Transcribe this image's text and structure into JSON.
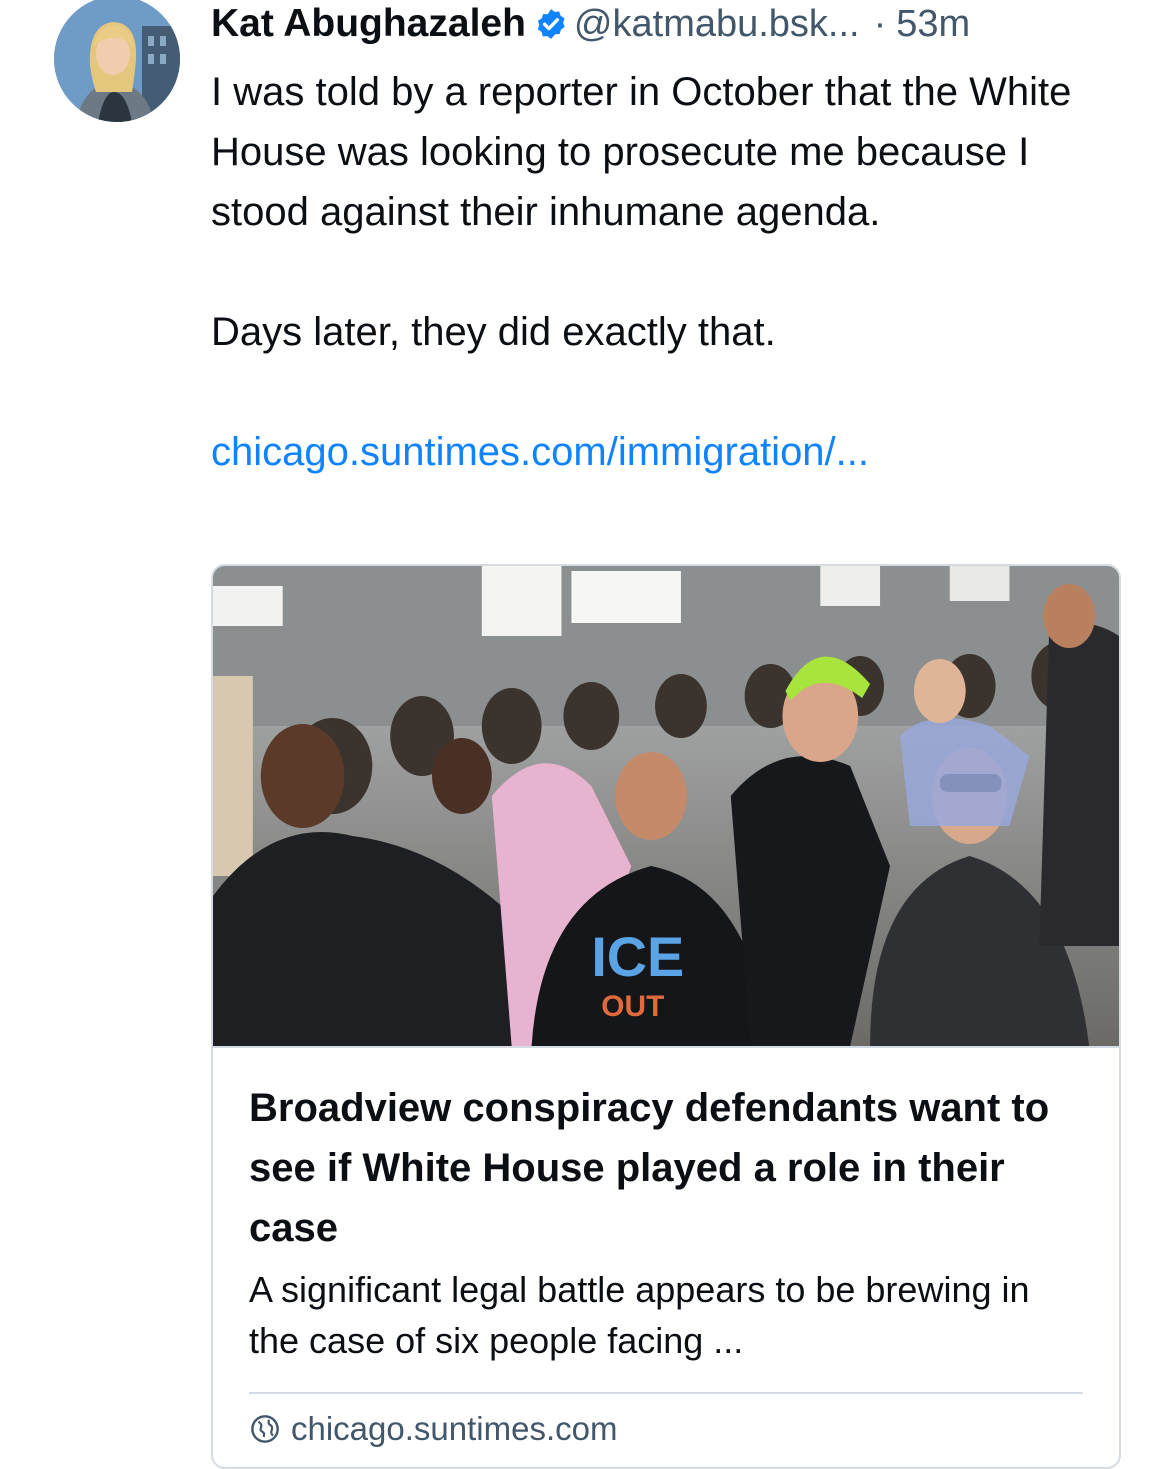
{
  "post": {
    "author": "Kat Abughazaleh",
    "handle": "@katmabu.bsk...",
    "separator": "·",
    "timestamp": "53m",
    "paragraphs": [
      "I was told by a reporter in October that the White House was looking to prosecute me because I stood against their inhumane agenda.",
      "Days later, they did exactly that."
    ],
    "link_text": "chicago.suntimes.com/immigration/..."
  },
  "embed": {
    "image_description": "protest-crowd-photo",
    "title": "Broadview conspiracy defendants want to see if White House played a role in their case",
    "description": "A significant legal battle appears to be brewing in the case of six people facing ...",
    "domain": "chicago.suntimes.com"
  },
  "colors": {
    "link": "#1083fe",
    "muted": "#42576b",
    "badge": "#1083fe",
    "border": "#d4dbe2"
  },
  "icons": {
    "verified": "verified-check-icon",
    "globe": "globe-icon"
  }
}
